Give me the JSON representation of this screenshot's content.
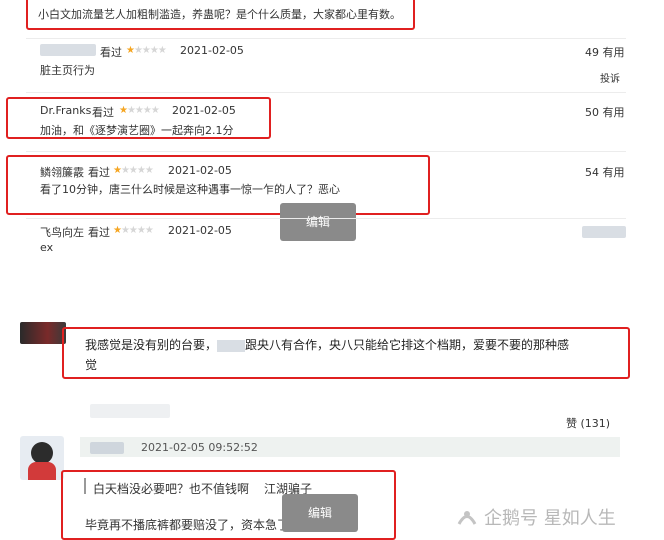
{
  "top_comment": {
    "text": "小白文加流量艺人加粗制滥造，养蛊呢？是个什么质量，大家都心里有数。"
  },
  "reviews": [
    {
      "user": "",
      "watched": "看过",
      "date": "2021-02-05",
      "votes": "49",
      "useful": "有用",
      "report": "投诉",
      "body": "脏主页行为"
    },
    {
      "user": "Dr.Franks",
      "watched": "看过",
      "date": "2021-02-05",
      "votes": "50",
      "useful": "有用",
      "body": "加油，和《逐梦演艺圈》一起奔向2.1分"
    },
    {
      "user": "鳞翎簾霰",
      "watched": "看过",
      "date": "2021-02-05",
      "votes": "54",
      "useful": "有用",
      "body": "看了10分钟，唐三什么时候是这种遇事一惊一乍的人了？恶心"
    },
    {
      "user": "飞鸟向左",
      "watched": "看过",
      "date": "2021-02-05",
      "votes": "",
      "useful": "",
      "body": "ex"
    }
  ],
  "edit_label": "编辑",
  "weibo_comment": {
    "text_line1": "我感觉是没有别的台要，",
    "text_mid": "跟央八有合作，央八只能给它排这个档期，爱要不要的那种感",
    "text_line2": "觉"
  },
  "like_label": "赞 (131)",
  "reply_time": "2021-02-05 09:52:52",
  "reply_quote": {
    "text": "白天档没必要吧？也不值钱啊",
    "author": "江湖骗子"
  },
  "reply_body": "毕竟再不播底裤都要赔没了，资本急了呗",
  "watermark": "企鹅号 星如人生",
  "colors": {
    "red_box": "#e02020",
    "star": "#f5a623",
    "link": "#3b73b9"
  }
}
